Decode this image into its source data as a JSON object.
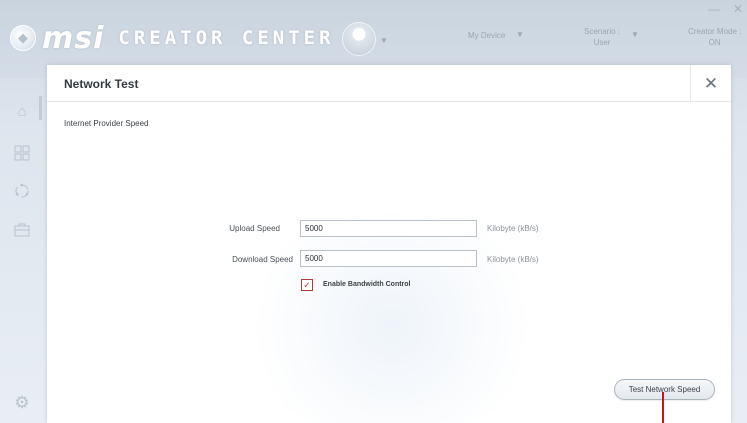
{
  "app": {
    "logo_text": "msi",
    "brand_text": "CREATOR CENTER"
  },
  "header": {
    "my_device": "My Device",
    "scenario_label": "Scenario :",
    "scenario_value": "User",
    "creator_mode_label": "Creator Mode :",
    "creator_mode_value": "ON",
    "minimize": "—",
    "close": "✕"
  },
  "sidebar": {
    "items": [
      {
        "icon": "home-icon"
      },
      {
        "icon": "grid-icon"
      },
      {
        "icon": "refresh-icon"
      },
      {
        "icon": "toolbox-icon"
      }
    ],
    "settings_icon": "gear-icon"
  },
  "dialog": {
    "title": "Network Test",
    "close_glyph": "✕",
    "section_label": "Internet Provider Speed",
    "upload": {
      "label": "Upload Speed",
      "value": "5000",
      "unit": "Kilobyte (kB/s)"
    },
    "download": {
      "label": "Download Speed",
      "value": "5000",
      "unit": "Kilobyte (kB/s)"
    },
    "bandwidth": {
      "label": "Enable Bandwidth Control",
      "checked": true
    },
    "test_button": "Test Network Speed"
  },
  "colors": {
    "accent_red": "#c5161d",
    "background": "#d4dde7"
  }
}
